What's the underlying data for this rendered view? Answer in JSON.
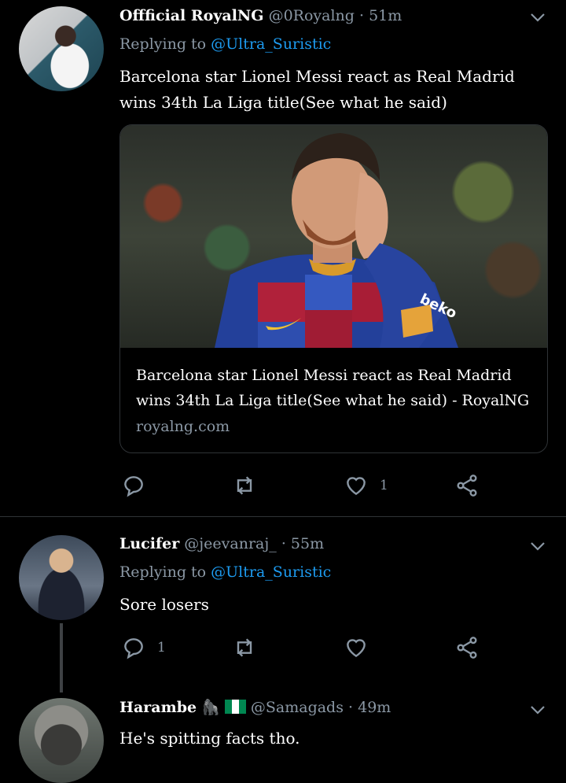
{
  "tweet1": {
    "name": "Offficial RoyalNG",
    "handle": "@0Royalng",
    "time": "51m",
    "reply_label": "Replying to",
    "reply_to": "@Ultra_Suristic",
    "text": "Barcelona star Lionel Messi react as Real Madrid wins 34th La Liga title(See what he said)",
    "card": {
      "title": "Barcelona star Lionel Messi react as Real Madrid wins 34th La Liga title(See what he said) - RoyalNG",
      "domain": "royalng.com"
    },
    "likes": "1"
  },
  "tweet2": {
    "name": "Lucifer",
    "handle": "@jeevanraj_",
    "time": "55m",
    "reply_label": "Replying to",
    "reply_to": "@Ultra_Suristic",
    "text": "Sore losers",
    "replies": "1"
  },
  "tweet3": {
    "name": "Harambe",
    "emoji": "🦍",
    "handle": "@Samagads",
    "time": "49m",
    "text": "He's spitting facts tho."
  },
  "separator": "·",
  "colors": {
    "background": "#000000",
    "link": "#1d9bf0",
    "muted": "#8b98a5"
  },
  "icons": [
    "reply-icon",
    "retweet-icon",
    "like-icon",
    "share-icon",
    "chevron-down-icon"
  ]
}
